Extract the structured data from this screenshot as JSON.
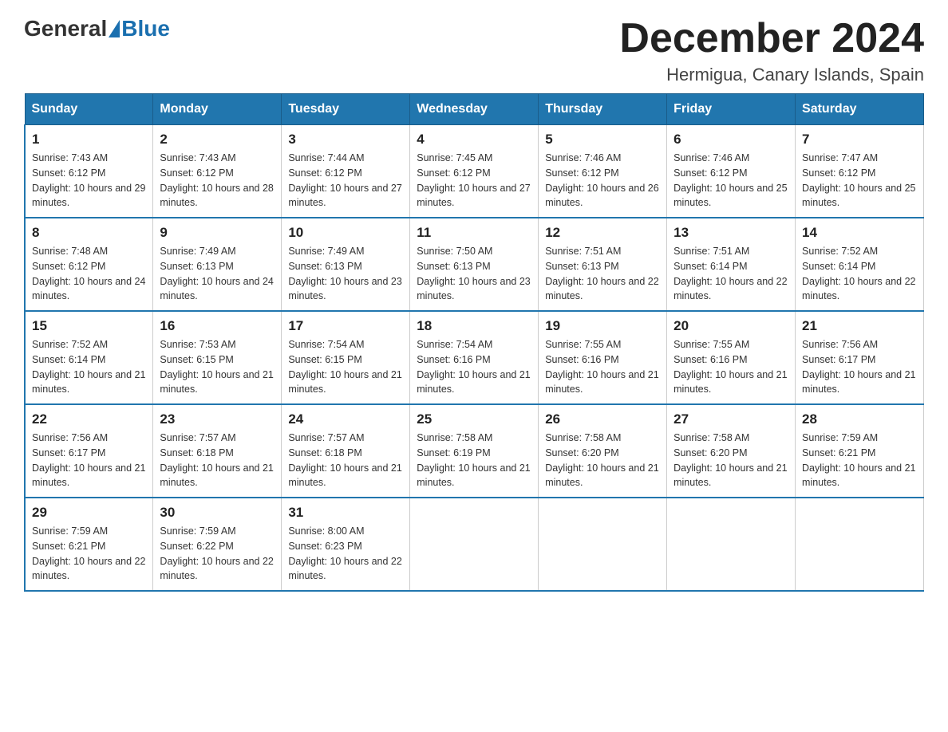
{
  "header": {
    "logo_general": "General",
    "logo_blue": "Blue",
    "month_title": "December 2024",
    "location": "Hermigua, Canary Islands, Spain"
  },
  "weekdays": [
    "Sunday",
    "Monday",
    "Tuesday",
    "Wednesday",
    "Thursday",
    "Friday",
    "Saturday"
  ],
  "weeks": [
    [
      {
        "day": "1",
        "sunrise": "7:43 AM",
        "sunset": "6:12 PM",
        "daylight": "10 hours and 29 minutes."
      },
      {
        "day": "2",
        "sunrise": "7:43 AM",
        "sunset": "6:12 PM",
        "daylight": "10 hours and 28 minutes."
      },
      {
        "day": "3",
        "sunrise": "7:44 AM",
        "sunset": "6:12 PM",
        "daylight": "10 hours and 27 minutes."
      },
      {
        "day": "4",
        "sunrise": "7:45 AM",
        "sunset": "6:12 PM",
        "daylight": "10 hours and 27 minutes."
      },
      {
        "day": "5",
        "sunrise": "7:46 AM",
        "sunset": "6:12 PM",
        "daylight": "10 hours and 26 minutes."
      },
      {
        "day": "6",
        "sunrise": "7:46 AM",
        "sunset": "6:12 PM",
        "daylight": "10 hours and 25 minutes."
      },
      {
        "day": "7",
        "sunrise": "7:47 AM",
        "sunset": "6:12 PM",
        "daylight": "10 hours and 25 minutes."
      }
    ],
    [
      {
        "day": "8",
        "sunrise": "7:48 AM",
        "sunset": "6:12 PM",
        "daylight": "10 hours and 24 minutes."
      },
      {
        "day": "9",
        "sunrise": "7:49 AM",
        "sunset": "6:13 PM",
        "daylight": "10 hours and 24 minutes."
      },
      {
        "day": "10",
        "sunrise": "7:49 AM",
        "sunset": "6:13 PM",
        "daylight": "10 hours and 23 minutes."
      },
      {
        "day": "11",
        "sunrise": "7:50 AM",
        "sunset": "6:13 PM",
        "daylight": "10 hours and 23 minutes."
      },
      {
        "day": "12",
        "sunrise": "7:51 AM",
        "sunset": "6:13 PM",
        "daylight": "10 hours and 22 minutes."
      },
      {
        "day": "13",
        "sunrise": "7:51 AM",
        "sunset": "6:14 PM",
        "daylight": "10 hours and 22 minutes."
      },
      {
        "day": "14",
        "sunrise": "7:52 AM",
        "sunset": "6:14 PM",
        "daylight": "10 hours and 22 minutes."
      }
    ],
    [
      {
        "day": "15",
        "sunrise": "7:52 AM",
        "sunset": "6:14 PM",
        "daylight": "10 hours and 21 minutes."
      },
      {
        "day": "16",
        "sunrise": "7:53 AM",
        "sunset": "6:15 PM",
        "daylight": "10 hours and 21 minutes."
      },
      {
        "day": "17",
        "sunrise": "7:54 AM",
        "sunset": "6:15 PM",
        "daylight": "10 hours and 21 minutes."
      },
      {
        "day": "18",
        "sunrise": "7:54 AM",
        "sunset": "6:16 PM",
        "daylight": "10 hours and 21 minutes."
      },
      {
        "day": "19",
        "sunrise": "7:55 AM",
        "sunset": "6:16 PM",
        "daylight": "10 hours and 21 minutes."
      },
      {
        "day": "20",
        "sunrise": "7:55 AM",
        "sunset": "6:16 PM",
        "daylight": "10 hours and 21 minutes."
      },
      {
        "day": "21",
        "sunrise": "7:56 AM",
        "sunset": "6:17 PM",
        "daylight": "10 hours and 21 minutes."
      }
    ],
    [
      {
        "day": "22",
        "sunrise": "7:56 AM",
        "sunset": "6:17 PM",
        "daylight": "10 hours and 21 minutes."
      },
      {
        "day": "23",
        "sunrise": "7:57 AM",
        "sunset": "6:18 PM",
        "daylight": "10 hours and 21 minutes."
      },
      {
        "day": "24",
        "sunrise": "7:57 AM",
        "sunset": "6:18 PM",
        "daylight": "10 hours and 21 minutes."
      },
      {
        "day": "25",
        "sunrise": "7:58 AM",
        "sunset": "6:19 PM",
        "daylight": "10 hours and 21 minutes."
      },
      {
        "day": "26",
        "sunrise": "7:58 AM",
        "sunset": "6:20 PM",
        "daylight": "10 hours and 21 minutes."
      },
      {
        "day": "27",
        "sunrise": "7:58 AM",
        "sunset": "6:20 PM",
        "daylight": "10 hours and 21 minutes."
      },
      {
        "day": "28",
        "sunrise": "7:59 AM",
        "sunset": "6:21 PM",
        "daylight": "10 hours and 21 minutes."
      }
    ],
    [
      {
        "day": "29",
        "sunrise": "7:59 AM",
        "sunset": "6:21 PM",
        "daylight": "10 hours and 22 minutes."
      },
      {
        "day": "30",
        "sunrise": "7:59 AM",
        "sunset": "6:22 PM",
        "daylight": "10 hours and 22 minutes."
      },
      {
        "day": "31",
        "sunrise": "8:00 AM",
        "sunset": "6:23 PM",
        "daylight": "10 hours and 22 minutes."
      },
      null,
      null,
      null,
      null
    ]
  ]
}
